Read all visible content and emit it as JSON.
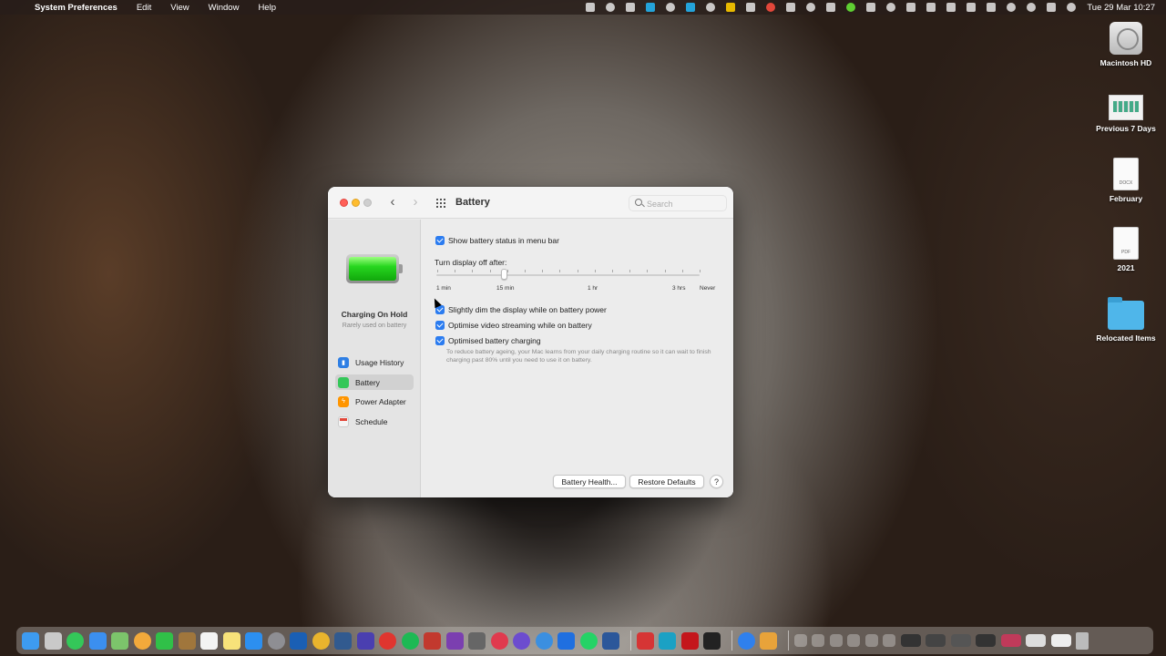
{
  "menubar": {
    "app_name": "System Preferences",
    "menus": [
      "Edit",
      "View",
      "Window",
      "Help"
    ],
    "clock": "Tue 29 Mar  10:27"
  },
  "desktop": {
    "icons": [
      {
        "label": "Macintosh HD",
        "icon": "hard-drive-icon"
      },
      {
        "label": "Previous 7 Days",
        "icon": "screenshot-icon"
      },
      {
        "label": "February",
        "icon": "docx-icon",
        "badge": "DOCX"
      },
      {
        "label": "2021",
        "icon": "pdf-icon",
        "badge": "PDF"
      },
      {
        "label": "Relocated Items",
        "icon": "folder-icon"
      }
    ]
  },
  "window": {
    "title": "Battery",
    "search_placeholder": "Search",
    "sidebar": {
      "status_title": "Charging On Hold",
      "status_subtitle": "Rarely used on battery",
      "items": [
        {
          "label": "Usage History",
          "icon": "usage-history-icon"
        },
        {
          "label": "Battery",
          "icon": "battery-icon",
          "selected": true
        },
        {
          "label": "Power Adapter",
          "icon": "power-adapter-icon"
        },
        {
          "label": "Schedule",
          "icon": "schedule-icon"
        }
      ]
    },
    "content": {
      "show_status_label": "Show battery status in menu bar",
      "show_status_checked": true,
      "slider_label": "Turn display off after:",
      "slider_value": "15 min",
      "slider_ticks": [
        "1 min",
        "15 min",
        "1 hr",
        "3 hrs",
        "Never"
      ],
      "dim_label": "Slightly dim the display while on battery power",
      "dim_checked": true,
      "video_label": "Optimise video streaming while on battery",
      "video_checked": true,
      "optimised_label": "Optimised battery charging",
      "optimised_checked": true,
      "optimised_hint": "To reduce battery ageing, your Mac learns from your daily charging routine so it can wait to finish charging past 80% until you need to use it on battery.",
      "battery_health_button": "Battery Health...",
      "restore_defaults_button": "Restore Defaults",
      "help_button": "?"
    }
  },
  "colors": {
    "accent": "#2b7cf0",
    "battery_green": "#27d61f"
  }
}
